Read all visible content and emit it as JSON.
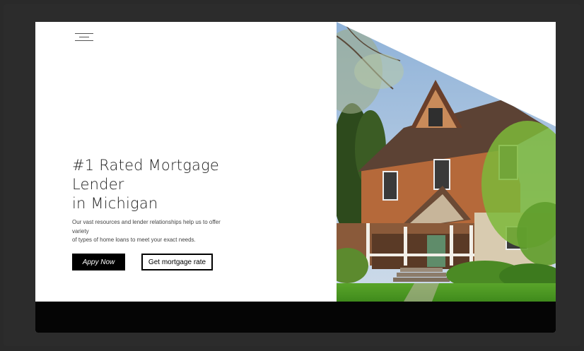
{
  "hero": {
    "title_line1": "#1 Rated Mortgage",
    "title_line2": "Lender",
    "title_line3": "in Michigan",
    "description_line1": "Our vast resources and lender relationships help us to offer",
    "description_line2": "variety",
    "description_line3": "of types of home loans to meet your exact needs."
  },
  "buttons": {
    "apply_label": "Appy Now",
    "rate_label": "Get mortgage rate"
  },
  "icons": {
    "menu": "hamburger-menu-icon"
  },
  "colors": {
    "primary_button": "#000000",
    "footer": "#050505",
    "background": "#ffffff"
  }
}
